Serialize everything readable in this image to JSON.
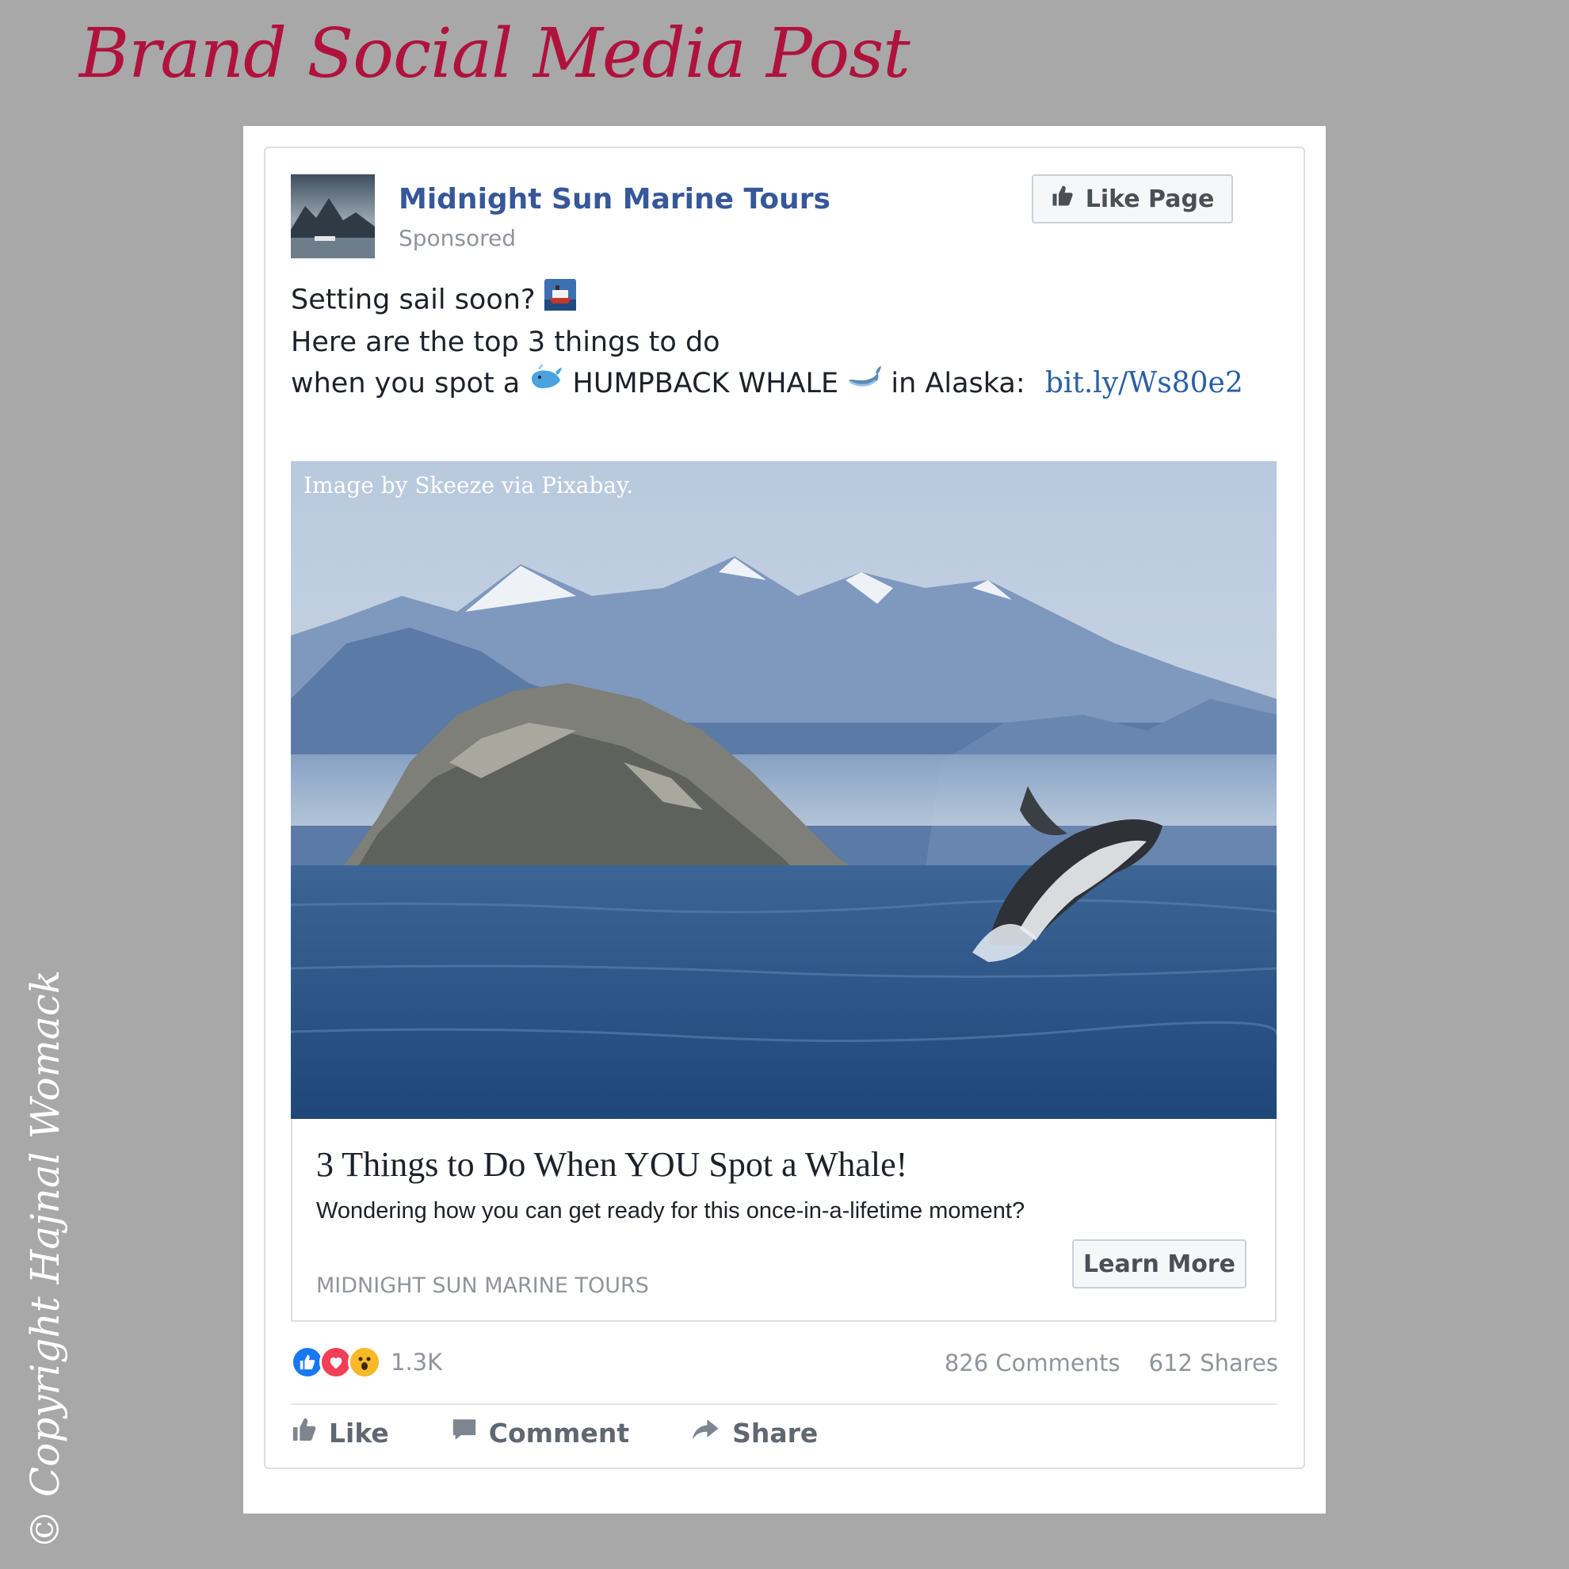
{
  "heading": "Brand Social Media Post",
  "copyright": "© Copyright Hajnal Womack",
  "post": {
    "page_name": "Midnight Sun Marine Tours",
    "sponsored": "Sponsored",
    "like_page_label": "Like Page",
    "text_line1": "Setting sail soon?",
    "text_line2": "Here are the top 3 things to do",
    "text_line3_a": "when you spot a",
    "text_line3_b": "HUMPBACK WHALE",
    "text_line3_c": "in Alaska:",
    "link": "bit.ly/Ws80e2",
    "image_credit": "Image by Skeeze via Pixabay.",
    "headline": "3 Things to Do When YOU Spot a Whale!",
    "description": "Wondering how you can get ready for this once-in-a-lifetime moment?",
    "domain": "MIDNIGHT SUN MARINE TOURS",
    "cta_label": "Learn More",
    "reaction_count": "1.3K",
    "comments": "826 Comments",
    "shares": "612 Shares",
    "actions": {
      "like": "Like",
      "comment": "Comment",
      "share": "Share"
    }
  },
  "colors": {
    "background": "#a8a8a8",
    "heading": "#b0123e",
    "page_name": "#365899",
    "link": "#2a5fa5",
    "muted": "#90949c",
    "like_reaction": "#1877f2",
    "love_reaction": "#f33e58",
    "wow_reaction": "#f7b928"
  },
  "icons": [
    "thumbs-up-icon",
    "ship-emoji-icon",
    "whale-emoji-icon",
    "whale2-emoji-icon",
    "like-reaction-icon",
    "love-reaction-icon",
    "wow-reaction-icon",
    "comment-icon",
    "share-icon"
  ]
}
